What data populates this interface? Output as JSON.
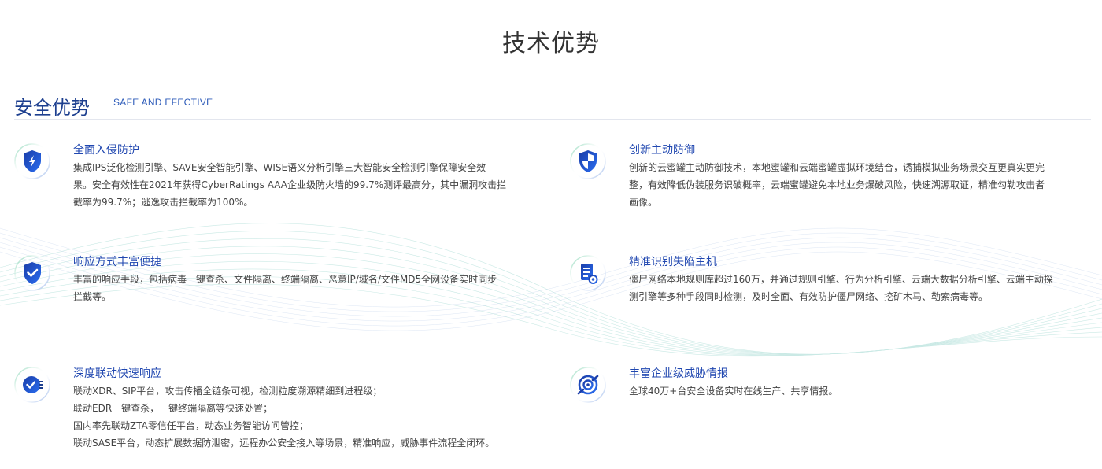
{
  "page": {
    "title": "技术优势"
  },
  "section": {
    "title": "安全优势",
    "subtitle": "SAFE AND EFECTIVE"
  },
  "features": [
    {
      "title": "全面入侵防护",
      "icon": "shield-bolt-icon",
      "lines": [
        "集成IPS泛化检测引擎、SAVE安全智能引擎、WISE语义分析引擎三大智能安全检测引擎保障安全效",
        "果。安全有效性在2021年获得CyberRatings AAA企业级防火墙的99.7%测评最高分，其中漏洞攻击拦",
        "截率为99.7%；逃逸攻击拦截率为100%。"
      ]
    },
    {
      "title": "创新主动防御",
      "icon": "shield-quadrant-icon",
      "lines": [
        "创新的云蜜罐主动防御技术，本地蜜罐和云端蜜罐虚拟环境结合，诱捕模拟业务场景交互更真实更完",
        "整，有效降低伪装服务识破概率，云端蜜罐避免本地业务爆破风险，快速溯源取证，精准勾勒攻击者",
        "画像。"
      ]
    },
    {
      "title": "响应方式丰富便捷",
      "icon": "shield-check-icon",
      "lines": [
        "丰富的响应手段，包括病毒一键查杀、文件隔离、终端隔离、恶意IP/域名/文件MD5全网设备实时同步",
        "拦截等。"
      ]
    },
    {
      "title": "精准识别失陷主机",
      "icon": "document-gear-icon",
      "lines": [
        "僵尸网络本地规则库超过160万，并通过规则引擎、行为分析引擎、云端大数据分析引擎、云端主动探",
        "测引擎等多种手段同时检测，及时全面、有效防护僵尸网络、挖矿木马、勒索病毒等。"
      ]
    },
    {
      "title": "深度联动快速响应",
      "icon": "checklist-icon",
      "lines": [
        "联动XDR、SIP平台，攻击传播全链条可视，检测粒度溯源精细到进程级；",
        "联动EDR一键查杀，一键终端隔离等快速处置；",
        "国内率先联动ZTA零信任平台，动态业务智能访问管控；",
        "联动SASE平台，动态扩展数据防泄密，远程办公安全接入等场景，精准响应，威胁事件流程全闭环。"
      ]
    },
    {
      "title": "丰富企业级威胁情报",
      "icon": "radar-icon",
      "lines": [
        "全球40万+台安全设备实时在线生产、共享情报。"
      ]
    }
  ],
  "colors": {
    "brand": "#1d3f8f",
    "accent": "#2047b0",
    "icon_gradient_start": "#1a3da8",
    "icon_gradient_end": "#2a6df0",
    "ring_green": "#7fd3b0",
    "ring_blue": "#c6d3ef"
  }
}
